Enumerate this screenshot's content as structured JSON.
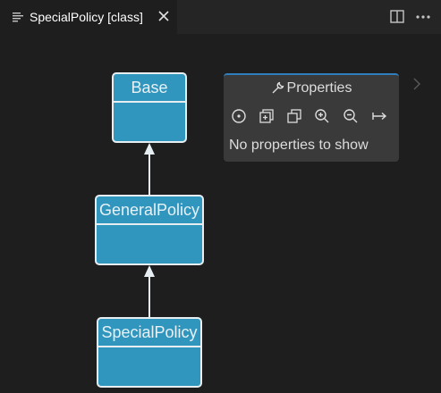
{
  "tab": {
    "title": "SpecialPolicy [class]"
  },
  "diagram": {
    "nodes": [
      {
        "id": "base",
        "label": "Base"
      },
      {
        "id": "general",
        "label": "GeneralPolicy"
      },
      {
        "id": "special",
        "label": "SpecialPolicy"
      }
    ]
  },
  "properties_panel": {
    "title": "Properties",
    "message": "No properties to show",
    "tools": [
      "center-icon",
      "add-icon",
      "copy-icon",
      "zoom-in-icon",
      "zoom-out-icon",
      "fit-width-icon"
    ]
  },
  "colors": {
    "editor_bg": "#1e1e1e",
    "node_fill": "#3196bd",
    "node_border": "#e6eef2",
    "panel_bg": "#3a3a3a",
    "panel_accent": "#2f7fbf"
  }
}
